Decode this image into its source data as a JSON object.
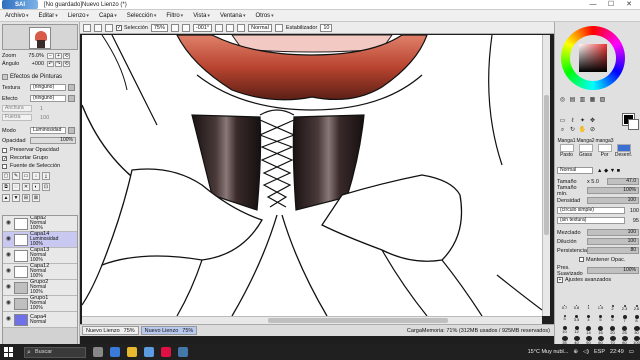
{
  "window": {
    "app_name": "SAI",
    "title": "[No guardado]Nuevo Lienzo (*)",
    "controls": [
      "—",
      "☐",
      "✕"
    ]
  },
  "menu": [
    {
      "label": "Archivo"
    },
    {
      "label": "Editar"
    },
    {
      "label": "Lienzo"
    },
    {
      "label": "Capa"
    },
    {
      "label": "Selección"
    },
    {
      "label": "Filtro"
    },
    {
      "label": "Vista"
    },
    {
      "label": "Ventana"
    },
    {
      "label": "Otros"
    }
  ],
  "navigator": {
    "zoom_label": "Zoom",
    "zoom_value": "75.0%",
    "angle_label": "Ángulo",
    "angle_value": "+000"
  },
  "effects": {
    "header": "Efectos de Pinturas",
    "texture_label": "Textura",
    "texture_value": "(ninguno)",
    "effect_label": "Efecto",
    "effect_value": "(ninguno)",
    "width_label": "Anchura",
    "width_value": "1",
    "strength_label": "Fuerza",
    "strength_value": "100"
  },
  "layer_props": {
    "mode_label": "Modo",
    "mode_value": "Luminosidad",
    "opacity_label": "Opacidad",
    "opacity_value": "100%",
    "preserve_opacity": "Preservar Opacidad",
    "clip_group": "Recortar Grupo",
    "selection_source": "Fuente de Selección"
  },
  "layers": [
    {
      "name": "Capa2",
      "mode": "Normal",
      "opacity": "100%",
      "kind": "layer",
      "selected": false
    },
    {
      "name": "Capa14",
      "mode": "Luminosidad",
      "opacity": "100%",
      "kind": "layer",
      "selected": true
    },
    {
      "name": "Capa13",
      "mode": "Normal",
      "opacity": "100%",
      "kind": "layer",
      "selected": false
    },
    {
      "name": "Capa12",
      "mode": "Normal",
      "opacity": "100%",
      "kind": "layer",
      "selected": false
    },
    {
      "name": "Grupo2",
      "mode": "Normal",
      "opacity": "100%",
      "kind": "folder",
      "selected": false
    },
    {
      "name": "Grupo1",
      "mode": "Normal",
      "opacity": "100%",
      "kind": "folder",
      "selected": false
    },
    {
      "name": "Capa4",
      "mode": "Normal",
      "opacity": "",
      "kind": "blue",
      "selected": false
    }
  ],
  "topbar": {
    "selection_label": "Selección",
    "selection_zoom": "75%",
    "angle_value": "-001°",
    "mode_value": "Normal",
    "stabilizer_label": "Estabilizador",
    "stabilizer_value": "10"
  },
  "status": {
    "tabs": [
      {
        "label": "Nuevo Lienzo",
        "zoom": "75%"
      },
      {
        "label": "Nuevo Lienzo",
        "zoom": "75%"
      }
    ],
    "memory": "CargaMemoria: 71% (312MB usados / 925MB reservados)"
  },
  "brush_panel": {
    "tabs": [
      "Manga1",
      "Manga2",
      "manga3"
    ],
    "sub_tabs": [
      "Pasto",
      "Grass",
      "Por",
      "Desenf."
    ],
    "mode_value": "Normal",
    "size_label": "Tamaño",
    "size_multiplier": "x 5.0",
    "size_value": "47.0",
    "min_size_label": "Tamaño mín.",
    "min_size_value": "100%",
    "density_label": "Densidad",
    "density_value": "100",
    "shape_value": "(círculo simple)",
    "shape_strength": "100",
    "texture_value": "(sin textura)",
    "texture_strength": "95",
    "blending_label": "Mezclado",
    "blending_value": "100",
    "dilution_label": "Dilución",
    "dilution_value": "100",
    "persistence_label": "Persistencia",
    "persistence_value": "80",
    "keep_opacity": "Mantener Opac.",
    "pressure_label": "Pres. Suavizado",
    "pressure_value": "100%",
    "advanced": "Ajustes avanzados",
    "brush_sizes": [
      "0.7",
      "0.8",
      "1",
      "1.5",
      "2",
      "2.3",
      "2.6",
      "3",
      "3.5",
      "4",
      "5",
      "6",
      "7",
      "8",
      "10",
      "12",
      "14",
      "16",
      "20",
      "25",
      "30",
      "35",
      "40",
      "50",
      "60",
      "70",
      "80",
      "100"
    ]
  },
  "taskbar": {
    "search_placeholder": "Buscar",
    "weather": "15°C  Muy nubl...",
    "lang": "ESP",
    "time": "22:49"
  },
  "colors": {
    "accent": "#3b6fd4",
    "selected_layer": "#c8c8f0",
    "ruffle_red": "#b8442f",
    "collar_dark": "#2a1e1e"
  }
}
